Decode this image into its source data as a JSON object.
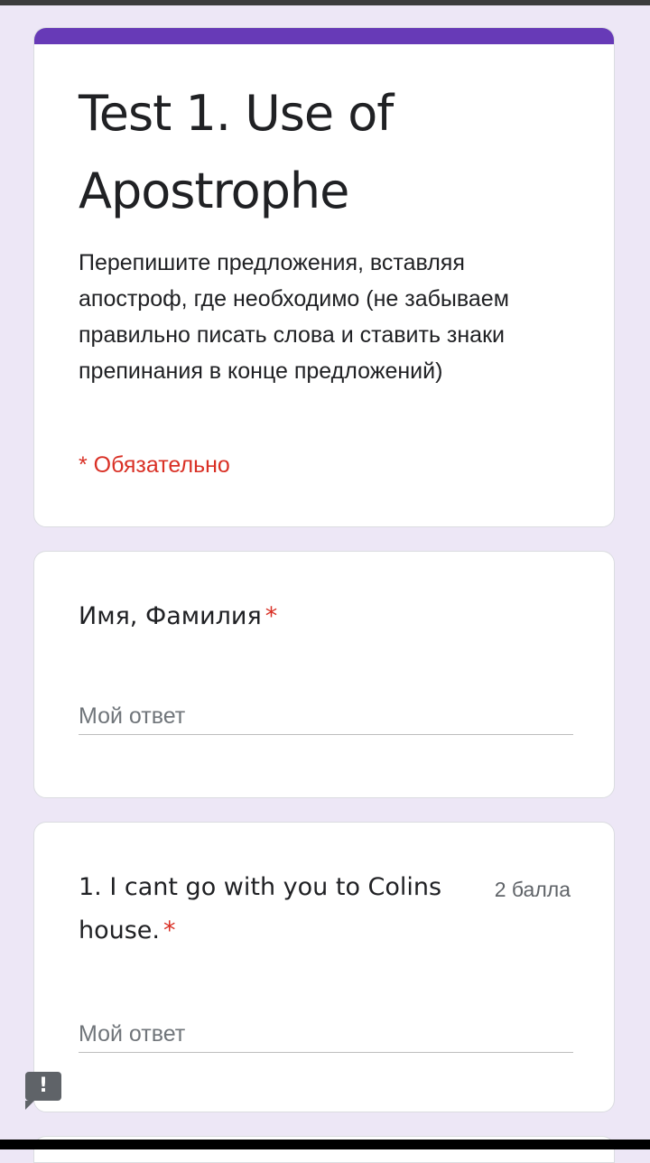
{
  "form": {
    "title": "Test 1. Use of Apostrophe",
    "description": "Перепишите предложения, вставляя апостроф, где необходимо (не забываем правильно писать слова и ставить знаки препинания в конце предложений)",
    "required_note": "* Обязательно"
  },
  "questions": [
    {
      "title": "Имя, Фамилия",
      "required_marker": "*",
      "answer_placeholder": "Мой ответ"
    },
    {
      "title": "1. I cant go with you to Colins house.",
      "required_marker": "*",
      "points": "2 балла",
      "answer_placeholder": "Мой ответ"
    }
  ],
  "icons": {
    "report": "exclamation-icon"
  },
  "colors": {
    "accent": "#673ab7",
    "background": "#ede7f6",
    "required": "#d93025"
  }
}
